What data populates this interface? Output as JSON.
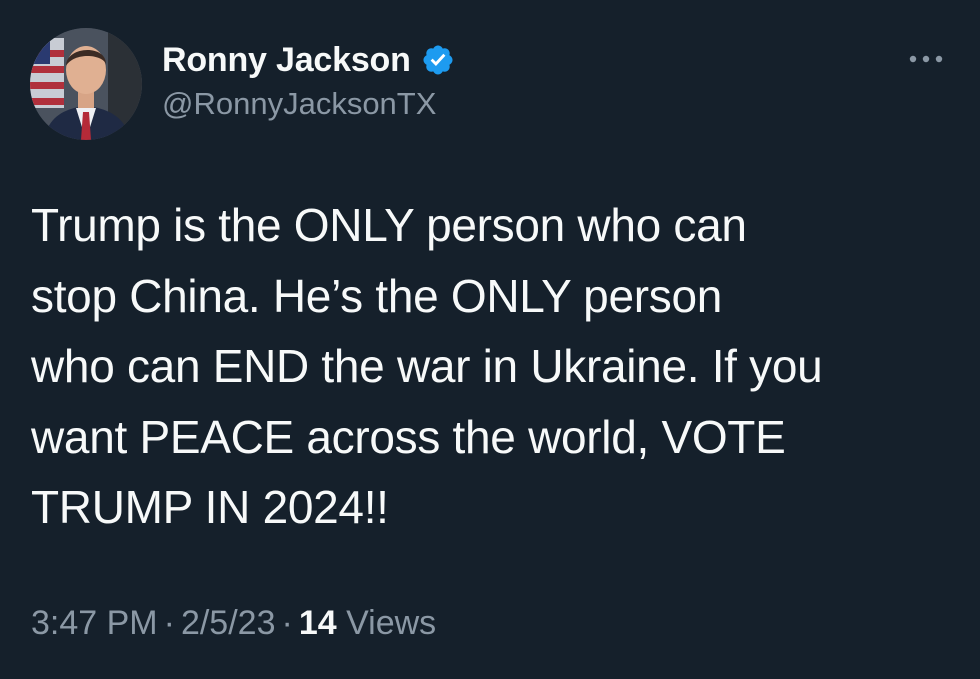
{
  "author": {
    "display_name": "Ronny Jackson",
    "handle": "@RonnyJacksonTX",
    "verified": true,
    "verified_color": "#1d9bf0"
  },
  "tweet": {
    "text": "Trump is the ONLY person who can\nstop China. He’s the ONLY person\nwho can END the war in Ukraine. If you\nwant PEACE across the world, VOTE\nTRUMP IN 2024!!"
  },
  "meta": {
    "time": "3:47 PM",
    "separator": "·",
    "date": "2/5/23",
    "views_count": "14",
    "views_label": "Views"
  },
  "icons": {
    "more": "more-horizontal-icon",
    "verified": "verified-badge-icon"
  },
  "colors": {
    "background": "#15202b",
    "primary_text": "#f7f9f9",
    "secondary_text": "#8b98a5"
  }
}
